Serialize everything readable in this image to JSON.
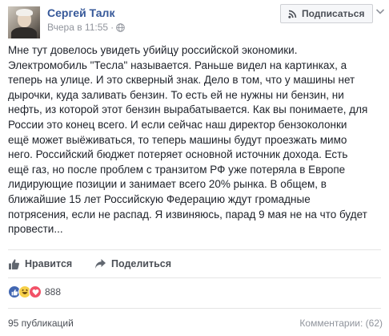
{
  "post": {
    "author": "Сергей Талк",
    "timestamp": "Вчера в 11:55",
    "privacy_icon": "globe-icon",
    "subscribe_label": "Подписаться",
    "subscribe_icon": "rss-icon",
    "text": "Мне тут довелось увидеть убийцу российской экономики.\nЭлектромобиль \"Тесла\" называется. Раньше видел на картинках, а\nтеперь на улице. И это скверный знак. Дело в том, что у машины нет\nдырочки, куда заливать бензин. То есть ей не нужны ни бензин, ни\nнефть, из которой этот бензин вырабатывается. Как вы понимаете, для\nРоссии это конец всего. И если сейчас наш директор бензоколонки\nещё может выёживаться, то теперь машины будут проезжать мимо\nнего. Российский бюджет потеряет основной источник дохода. Есть\nещё газ, но после проблем с транзитом РФ уже потеряла в Европе\nлидирующие позиции и занимает всего 20% рынка. В общем, в\nближайшие 15 лет Российскую Федерацию ждут громадные\nпотрясения, если не распад. Я извиняюсь, парад 9 мая не на что будет\nпровести..."
  },
  "actions": {
    "like_label": "Нравится",
    "share_label": "Поделиться"
  },
  "reactions": {
    "types": [
      "like",
      "haha",
      "love"
    ],
    "count": "888"
  },
  "footer": {
    "publications": "95 публикаций",
    "comments": "Комментарии: (62)"
  },
  "colors": {
    "link": "#365899",
    "like": "#4267b2",
    "haha": "#f7d04a",
    "love": "#f25268"
  }
}
